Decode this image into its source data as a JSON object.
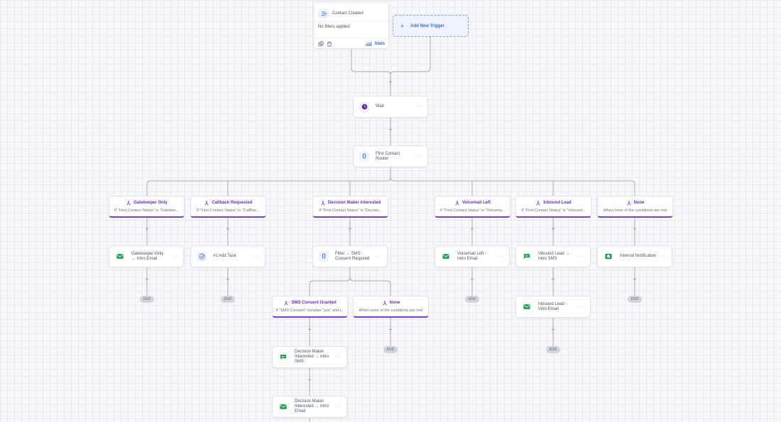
{
  "trigger": {
    "title": "Contact Created",
    "filters": "No filters applied",
    "stats_label": "Stats",
    "icon": "user-plus-icon"
  },
  "add_trigger": {
    "label": "Add New Trigger",
    "icon": "plus-icon"
  },
  "wait": {
    "label": "Wait",
    "icon": "clock-icon"
  },
  "router": {
    "label": "First Contact Router",
    "icon": "braces-icon"
  },
  "branches": [
    {
      "title": "Gatekeeper Only",
      "sub": "If \"First Contact Status\" is \"Gatekee..."
    },
    {
      "title": "Callback Requested",
      "sub": "If \"First Contact Status\" is \"CallBac..."
    },
    {
      "title": "Decision Maker Interested",
      "sub": "If \"First Contact Status\" is \"Decisio..."
    },
    {
      "title": "Voicemail Left",
      "sub": "If \"First Contact Status\" is \"Voicema..."
    },
    {
      "title": "Inbound Lead",
      "sub": "If \"First Contact Status\" is \"Inbound..."
    },
    {
      "title": "None",
      "sub": "When none of the conditions are met"
    }
  ],
  "sub_branches": [
    {
      "title": "SMS Consent Granted",
      "sub": "If \"SMS Consent\" includes \"yes\" and i..."
    },
    {
      "title": "None",
      "sub": "When none of the conditions are met"
    }
  ],
  "actions": {
    "gatekeeper_email": "Gatekeeper Only → Intro Email",
    "add_task": "#1 Add Task",
    "sms_filter": "Filter → SMS Consent Required",
    "voicemail_email": "Voicemail Left - Intro Email",
    "inbound_sms": "Inbound Lead → Intro SMS",
    "internal_notification": "Internal Notification",
    "inbound_email": "Inbound Lead - Intro Email",
    "dm_sms": "Decision Maker Interested → Intro SMS",
    "dm_email": "Decision Maker Interested → Intro Email"
  },
  "end_label": "END",
  "menu_dots": "···",
  "plus_symbol": "+",
  "colors": {
    "accent": "#7c3aed",
    "link": "#2f6fe0",
    "email_green": "#16a34a",
    "edge": "#a7acb5"
  }
}
